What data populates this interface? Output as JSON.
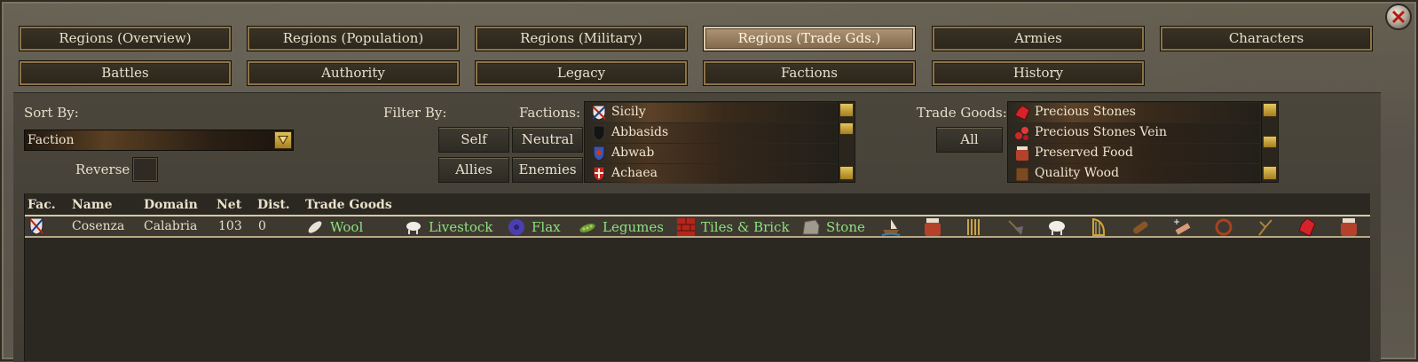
{
  "tabs_row1": [
    "Regions (Overview)",
    "Regions (Population)",
    "Regions (Military)",
    "Regions (Trade Gds.)",
    "Armies",
    "Characters"
  ],
  "tabs_row2": [
    "Battles",
    "Authority",
    "Legacy",
    "Factions",
    "History"
  ],
  "active_tab": "Regions (Trade Gds.)",
  "sort": {
    "label": "Sort By:",
    "value": "Faction",
    "reverse_label": "Reverse",
    "reverse_checked": false
  },
  "filter": {
    "label": "Filter By:",
    "self": "Self",
    "neutral": "Neutral",
    "allies": "Allies",
    "enemies": "Enemies"
  },
  "factions": {
    "label": "Factions:",
    "items": [
      "Sicily",
      "Abbasids",
      "Abwab",
      "Achaea"
    ]
  },
  "trade_goods_filter": {
    "label": "Trade Goods:",
    "all": "All",
    "items": [
      "Precious Stones",
      "Precious Stones Vein",
      "Preserved Food",
      "Quality Wood"
    ]
  },
  "table": {
    "headers": {
      "fac": "Fac.",
      "name": "Name",
      "domain": "Domain",
      "net": "Net",
      "dist": "Dist.",
      "goods": "Trade Goods"
    },
    "rows": [
      {
        "name": "Cosenza",
        "domain": "Calabria",
        "net": "103",
        "dist": "0",
        "goods": [
          "Wool",
          "Livestock",
          "Flax",
          "Legumes",
          "Tiles & Brick",
          "Stone"
        ],
        "resource_icons": [
          "ship-icon",
          "jar-icon",
          "wheat-icon",
          "pickaxe-icon",
          "sheep-icon",
          "harp-icon",
          "log-icon",
          "tool-icon",
          "ring-icon",
          "slingshot-icon",
          "gem-icon",
          "jar-icon"
        ]
      }
    ]
  },
  "colors": {
    "good_text": "#8fe07e",
    "accent_gold": "#8d7348"
  }
}
